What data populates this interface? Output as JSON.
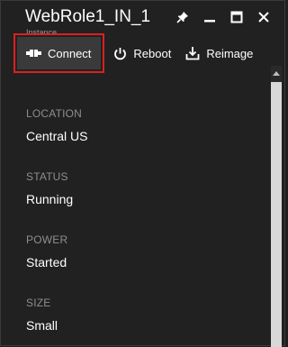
{
  "header": {
    "title": "WebRole1_IN_1",
    "subtitle": "Instance"
  },
  "window_controls": [
    "pin-icon",
    "minimize-icon",
    "maximize-icon",
    "close-icon"
  ],
  "commands": {
    "connect": "Connect",
    "reboot": "Reboot",
    "reimage": "Reimage"
  },
  "fields": [
    {
      "label": "LOCATION",
      "value": "Central US"
    },
    {
      "label": "STATUS",
      "value": "Running"
    },
    {
      "label": "POWER",
      "value": "Started"
    },
    {
      "label": "SIZE",
      "value": "Small"
    }
  ],
  "colors": {
    "background": "#212121",
    "highlight_border": "#e01e1e",
    "label": "#8e8e8e",
    "value": "#ffffff"
  }
}
